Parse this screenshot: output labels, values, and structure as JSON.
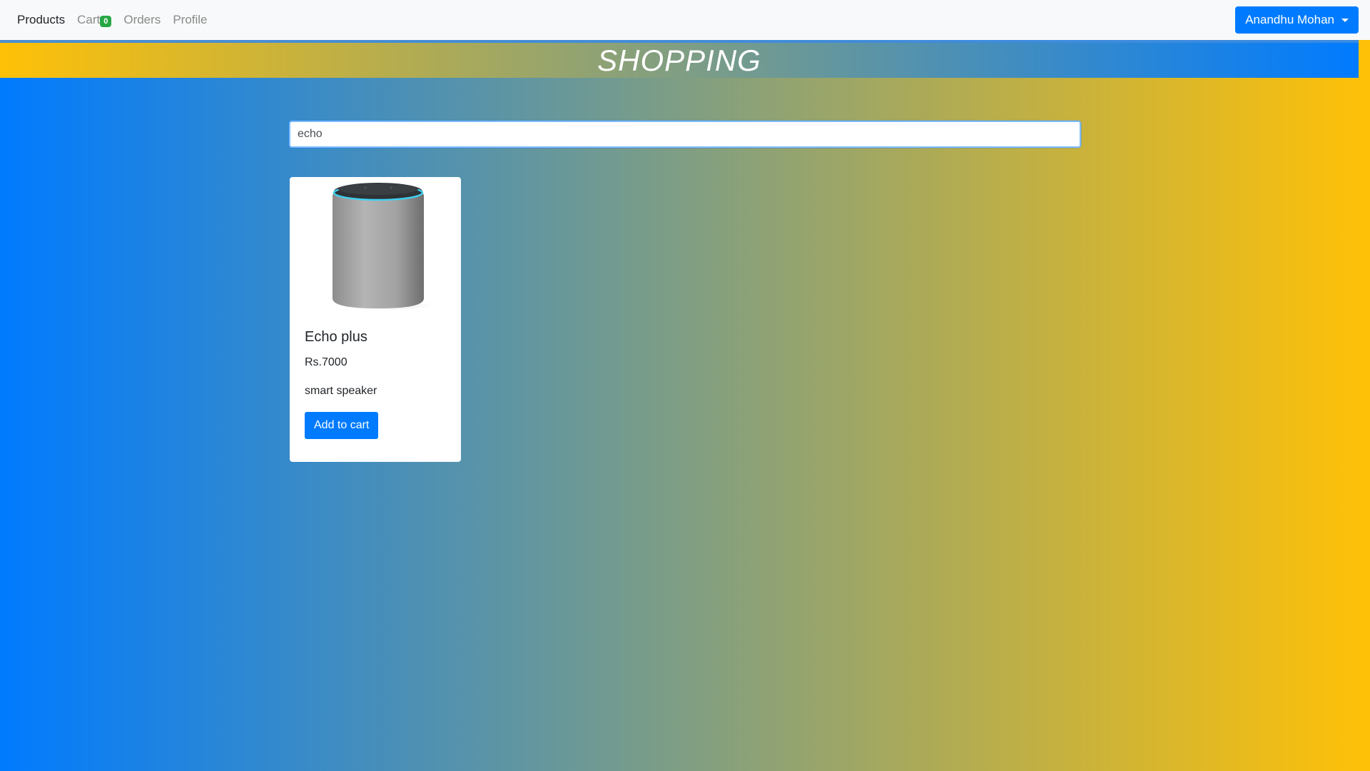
{
  "nav": {
    "items": [
      {
        "label": "Products",
        "active": true
      },
      {
        "label": "Cart",
        "badge": "0"
      },
      {
        "label": "Orders"
      },
      {
        "label": "Profile"
      }
    ],
    "user_name": "Anandhu Mohan"
  },
  "banner": {
    "title": "SHOPPING"
  },
  "search": {
    "value": "echo "
  },
  "products": [
    {
      "name": "Echo plus",
      "price": "Rs.7000",
      "description": "smart speaker",
      "button": "Add to cart",
      "image_icon": "smart-speaker-image"
    }
  ],
  "colors": {
    "primary": "#007bff",
    "accent": "#ffc107",
    "badge": "#28a745",
    "navbar_bg": "#f8f9fa"
  }
}
